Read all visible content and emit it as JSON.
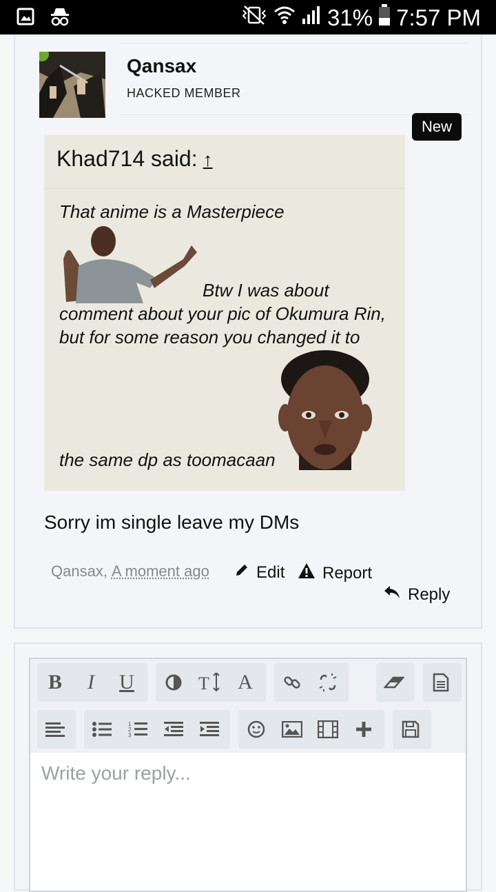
{
  "statusbar": {
    "battery": "31%",
    "time": "7:57 PM"
  },
  "post": {
    "username": "Qansax",
    "user_title": "HACKED MEMBER",
    "new_badge": "New",
    "quote": {
      "author": "Khad714 said:",
      "arrow": "↑",
      "line1": "That anime is a Masterpiece",
      "line2": "Btw I was about",
      "line3": "comment about your pic of Okumura Rin,",
      "line4": "but for some reason you changed it to",
      "line5": "the same dp as toomacaan"
    },
    "body": "Sorry im single leave my DMs",
    "meta_user": "Qansax,",
    "meta_time": "A moment ago",
    "edit_label": "Edit",
    "report_label": "Report",
    "reply_label": "Reply"
  },
  "editor": {
    "placeholder": "Write your reply..."
  },
  "colors": {
    "status_bar": "#000000",
    "quote_bg": "#ebe9df",
    "badge_bg": "#0b0b0b",
    "muted_text": "#888888"
  }
}
